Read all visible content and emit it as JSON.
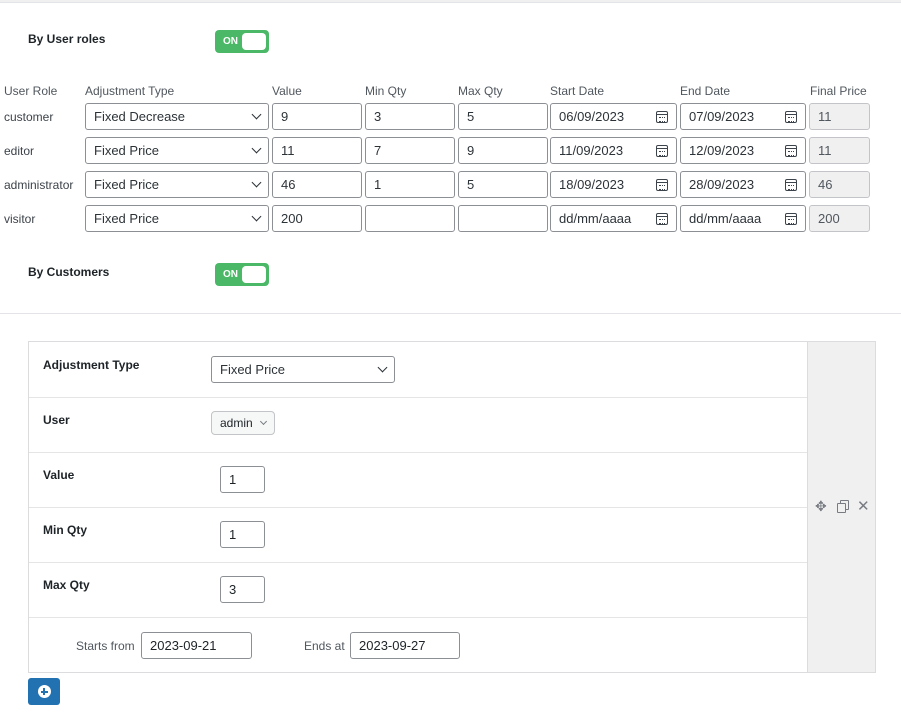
{
  "user_roles_section": {
    "label": "By User roles",
    "toggle_label": "ON",
    "headers": [
      "User Role",
      "Adjustment Type",
      "Value",
      "Min Qty",
      "Max Qty",
      "Start Date",
      "End Date",
      "Final Price"
    ],
    "rows": [
      {
        "role": "customer",
        "adjustment": "Fixed Decrease",
        "value": "9",
        "min": "3",
        "max": "5",
        "start": "06/09/2023",
        "end": "07/09/2023",
        "final": "11"
      },
      {
        "role": "editor",
        "adjustment": "Fixed Price",
        "value": "11",
        "min": "7",
        "max": "9",
        "start": "11/09/2023",
        "end": "12/09/2023",
        "final": "11"
      },
      {
        "role": "administrator",
        "adjustment": "Fixed Price",
        "value": "46",
        "min": "1",
        "max": "5",
        "start": "18/09/2023",
        "end": "28/09/2023",
        "final": "46"
      },
      {
        "role": "visitor",
        "adjustment": "Fixed Price",
        "value": "200",
        "min": "",
        "max": "",
        "start": "dd/mm/aaaa",
        "end": "dd/mm/aaaa",
        "final": "200"
      }
    ]
  },
  "customers_section": {
    "label": "By Customers",
    "toggle_label": "ON",
    "adjustment_label": "Adjustment Type",
    "adjustment_value": "Fixed Price",
    "user_label": "User",
    "user_value": "admin",
    "value_label": "Value",
    "value": "1",
    "min_label": "Min Qty",
    "min_value": "1",
    "max_label": "Max Qty",
    "max_value": "3",
    "starts_label": "Starts from",
    "starts_value": "2023-09-21",
    "ends_label": "Ends at",
    "ends_value": "2023-09-27"
  },
  "icons": {
    "move": "move-icon",
    "duplicate": "duplicate-icon",
    "remove": "close-icon",
    "add": "add-circle-icon",
    "calendar": "calendar-icon"
  },
  "colors": {
    "toggle_on": "#4ab866",
    "primary_button": "#2271b1"
  }
}
